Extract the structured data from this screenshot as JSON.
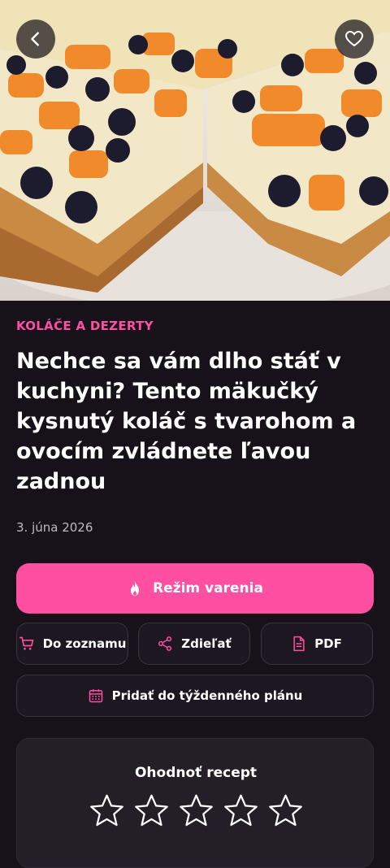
{
  "hero": {
    "image": "fruit-cake-photo"
  },
  "colors": {
    "accent": "#ff4fa3",
    "background": "#17121a",
    "card": "#241e27"
  },
  "header": {
    "back_icon": "chevron-left-icon",
    "favorite_icon": "heart-icon"
  },
  "article": {
    "category": "KOLÁČE A DEZERTY",
    "title": "Nechce sa vám dlho stáť v kuchyni? Tento mäkučký kysnutý koláč s tvarohom a ovocím zvládnete ľavou zadnou",
    "date": "3. júna 2026"
  },
  "actions": {
    "cook_mode": {
      "label": "Režim varenia",
      "icon": "flame-icon"
    },
    "add_to_list": {
      "label": "Do zoznamu",
      "icon": "cart-icon"
    },
    "share": {
      "label": "Zdieľať",
      "icon": "share-icon"
    },
    "pdf": {
      "label": "PDF",
      "icon": "document-icon"
    },
    "weekly_plan": {
      "label": "Pridať do týždenného plánu",
      "icon": "calendar-icon"
    }
  },
  "rating": {
    "title": "Ohodnoť recept",
    "stars_total": 5,
    "stars_selected": 0
  }
}
